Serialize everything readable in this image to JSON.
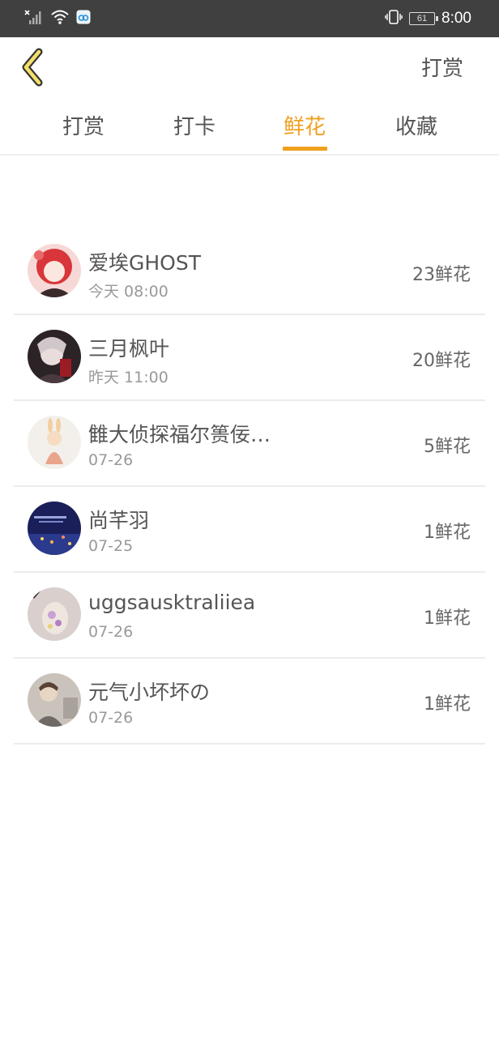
{
  "status_bar": {
    "time": "8:00",
    "battery": "61",
    "icons": [
      "signal-off-icon",
      "wifi-icon",
      "hotspot-icon",
      "vibrate-icon",
      "battery-icon"
    ]
  },
  "header": {
    "back_icon": "chevron-left-icon",
    "action_label": "打赏"
  },
  "tabs": [
    {
      "label": "打赏",
      "active": false
    },
    {
      "label": "打卡",
      "active": false
    },
    {
      "label": "鲜花",
      "active": true
    },
    {
      "label": "收藏",
      "active": false
    }
  ],
  "accent_color": "#f0a020",
  "list": [
    {
      "name": "爱埃GHOST",
      "time": "今天 08:00",
      "amount": "23鲜花"
    },
    {
      "name": "三月枫叶",
      "time": "昨天 11:00",
      "amount": "20鲜花"
    },
    {
      "name": "雔大侦探福尔篑佞…",
      "time": "07-26",
      "amount": "5鲜花"
    },
    {
      "name": "尚芊羽",
      "time": "07-25",
      "amount": "1鲜花"
    },
    {
      "name": "uggsausktraliiea",
      "time": "07-26",
      "amount": "1鲜花"
    },
    {
      "name": "元气小坏坏の",
      "time": "07-26",
      "amount": "1鲜花"
    }
  ]
}
